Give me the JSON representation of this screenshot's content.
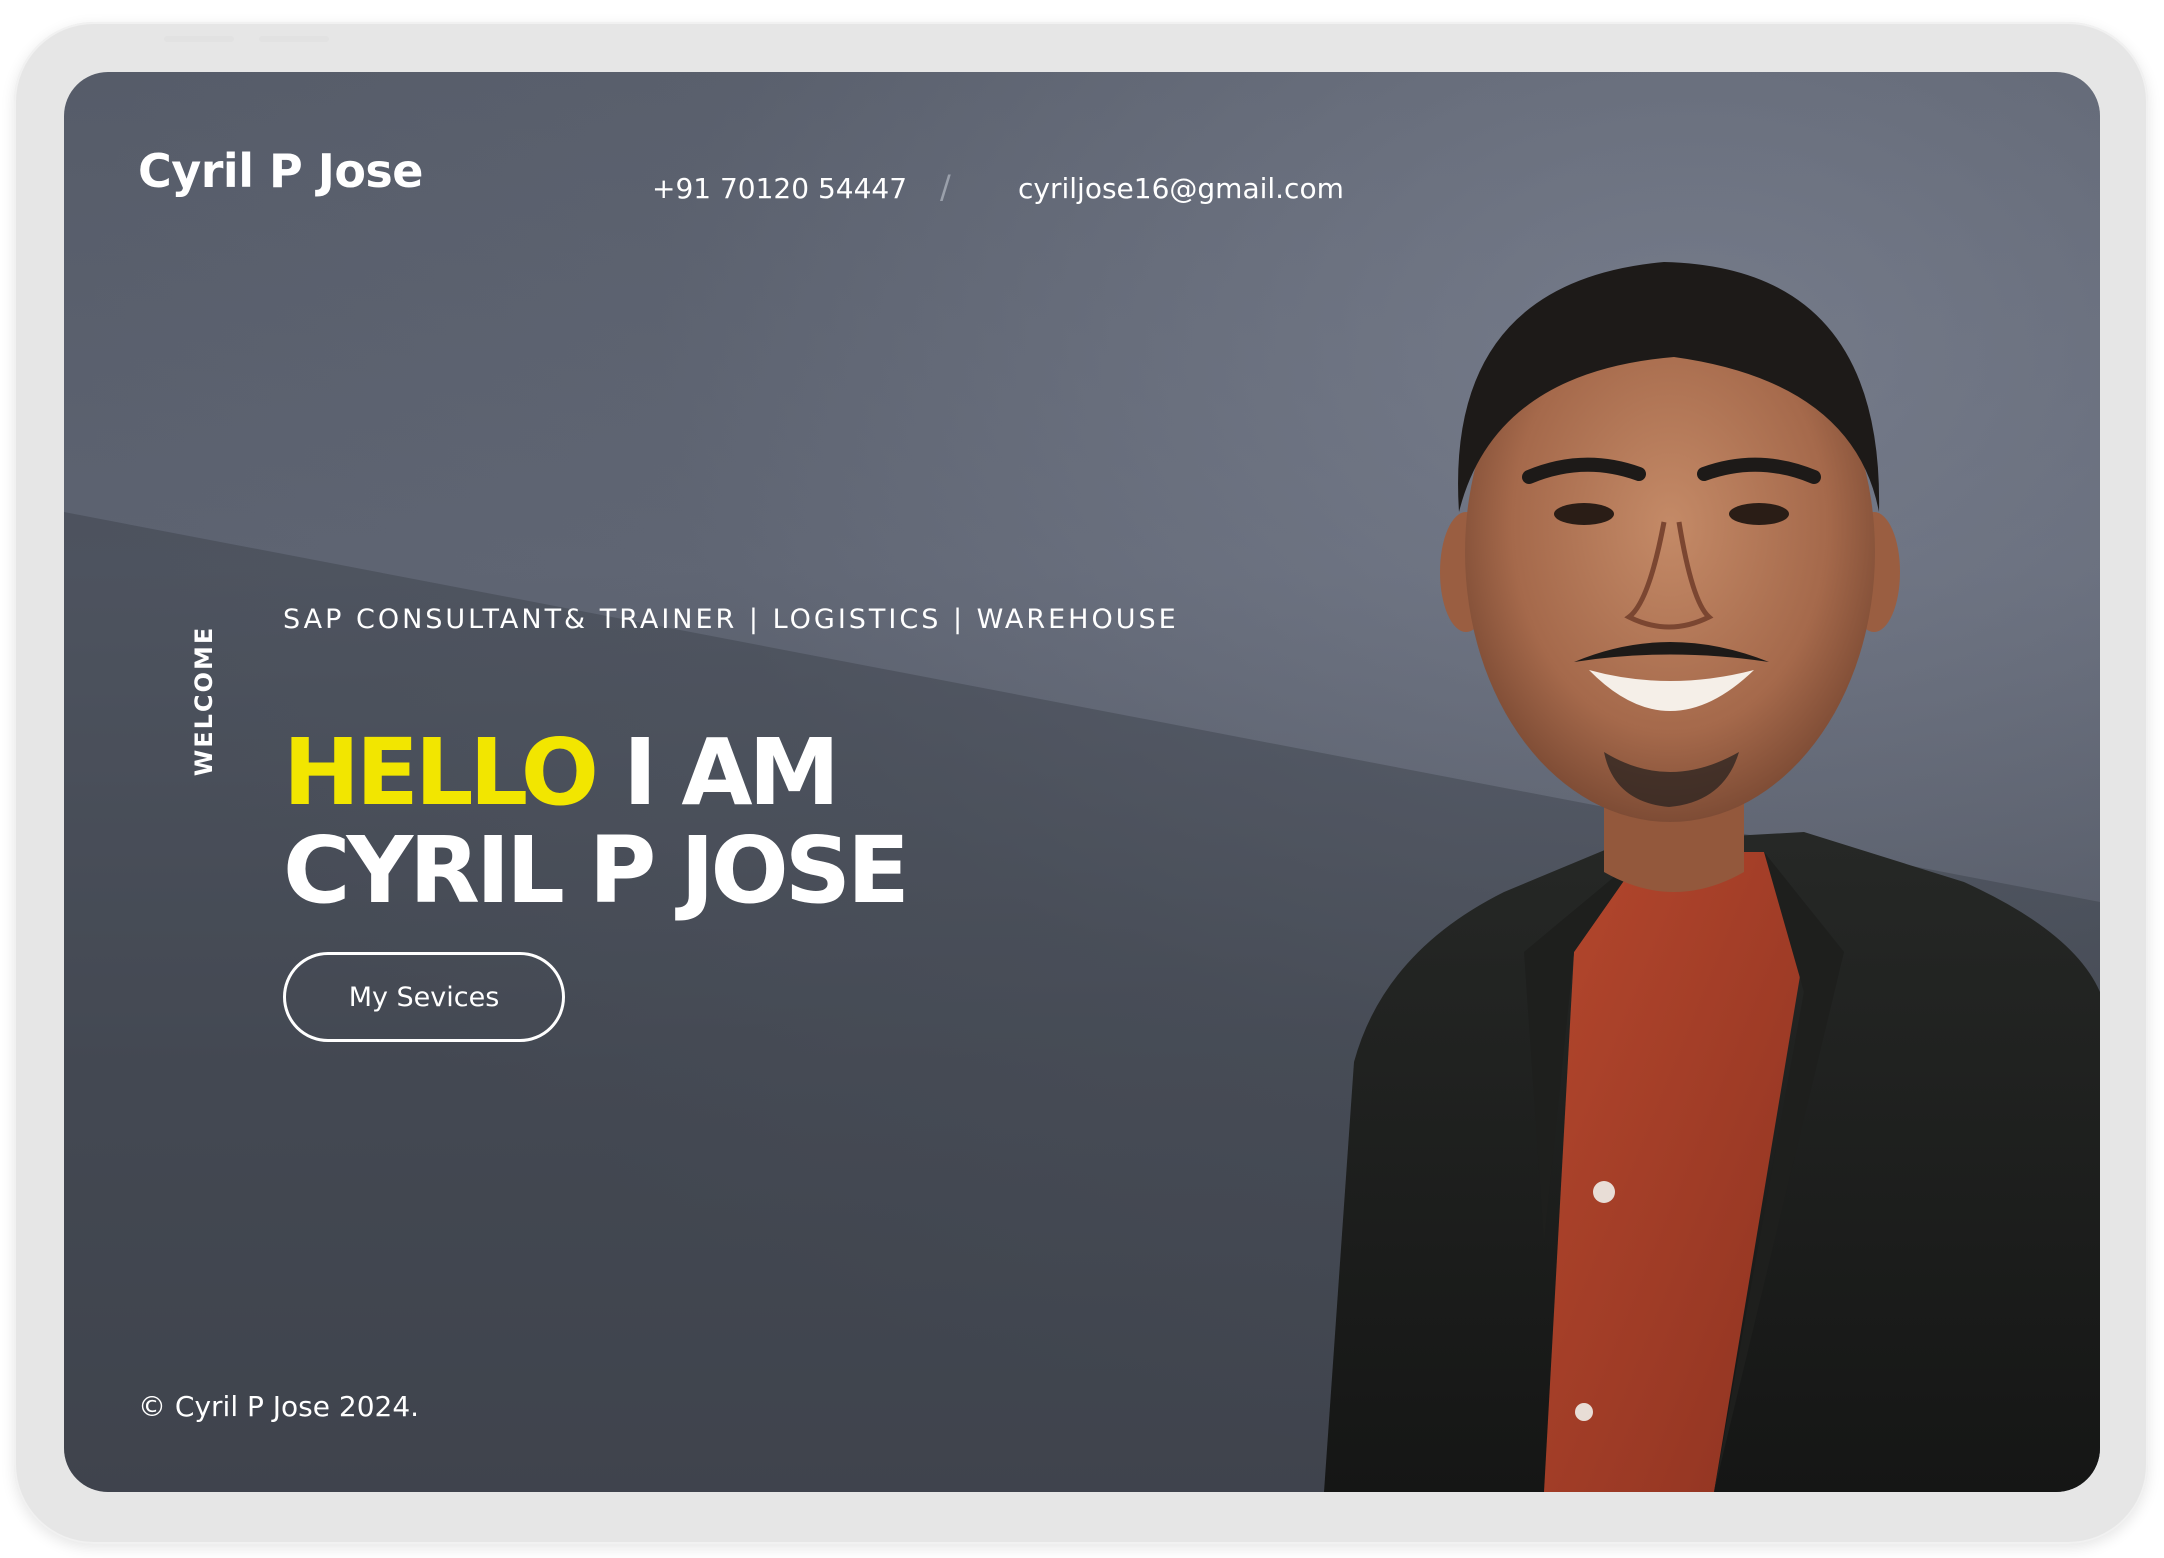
{
  "header": {
    "brand": "Cyril P Jose",
    "phone": "+91 70120 54447",
    "separator": "/",
    "email": "cyriljose16@gmail.com"
  },
  "hero": {
    "side_label": "WELCOME",
    "subtitle": "SAP CONSULTANT& TRAINER | LOGISTICS | WAREHOUSE",
    "headline_accent": "HELLO",
    "headline_rest": " I AM",
    "headline_line2": "CYRIL P JOSE",
    "cta_label": "My Sevices"
  },
  "footer": {
    "copyright": "© Cyril P Jose 2024."
  },
  "colors": {
    "accent": "#f2e600",
    "background": "#575d6a",
    "text": "#ffffff"
  },
  "images": {
    "portrait": "person-portrait"
  }
}
